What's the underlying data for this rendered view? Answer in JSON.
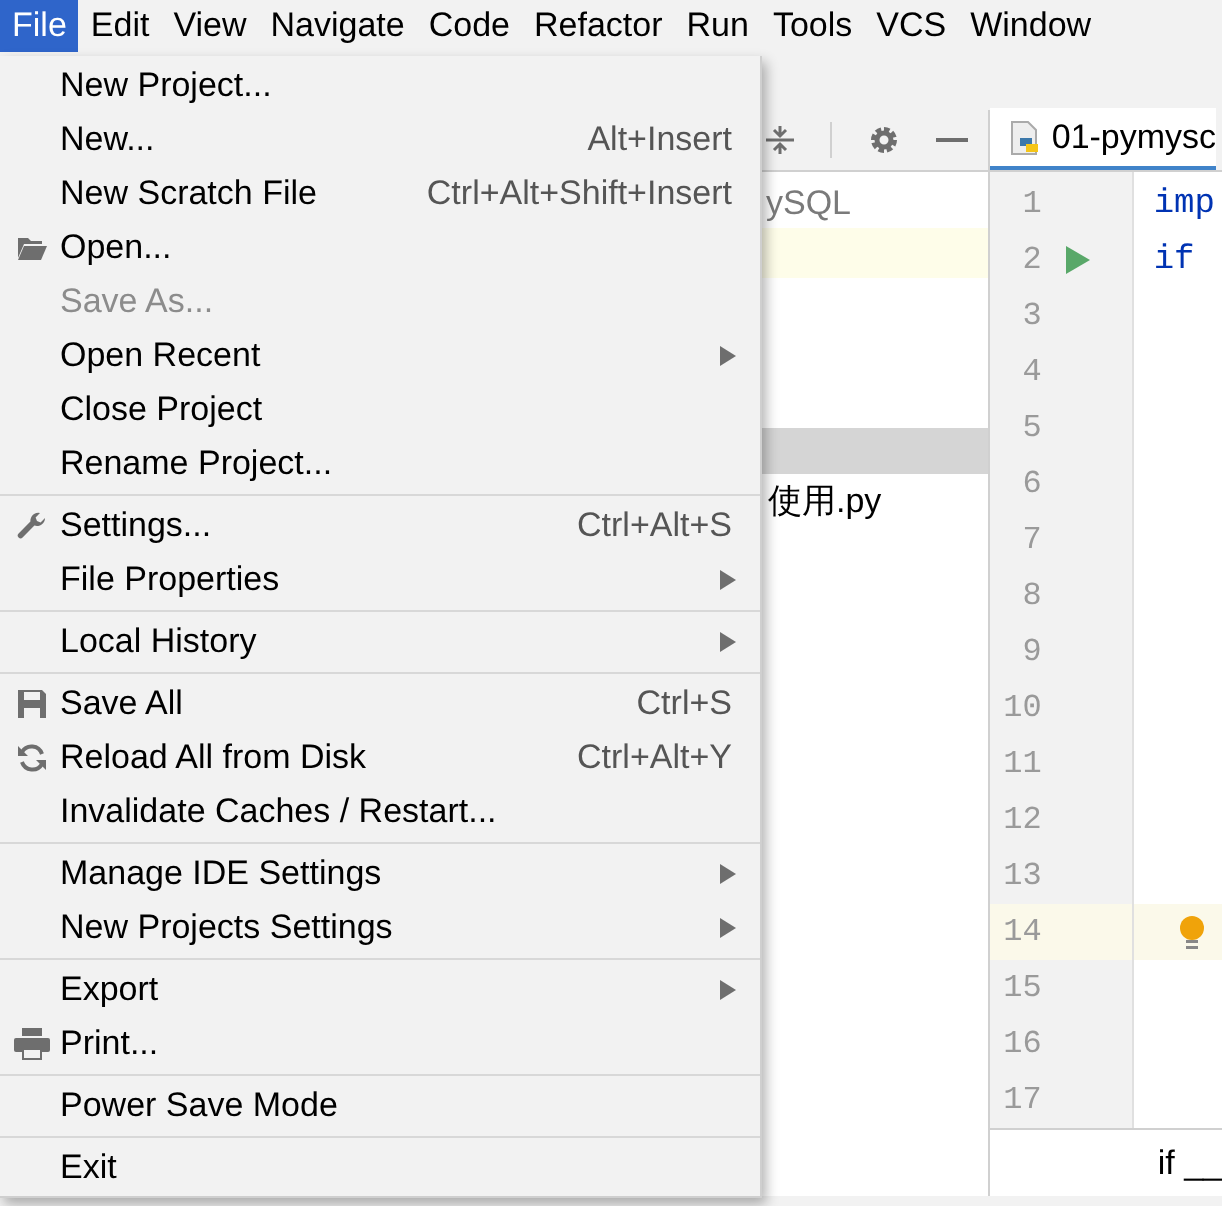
{
  "menu_bar": [
    {
      "label": "File",
      "selected": true
    },
    {
      "label": "Edit",
      "selected": false
    },
    {
      "label": "View",
      "selected": false
    },
    {
      "label": "Navigate",
      "selected": false
    },
    {
      "label": "Code",
      "selected": false
    },
    {
      "label": "Refactor",
      "selected": false
    },
    {
      "label": "Run",
      "selected": false
    },
    {
      "label": "Tools",
      "selected": false
    },
    {
      "label": "VCS",
      "selected": false
    },
    {
      "label": "Window",
      "selected": false
    }
  ],
  "file_menu": [
    {
      "kind": "item",
      "label": "New Project...",
      "disabled": false,
      "submenu": false
    },
    {
      "kind": "item",
      "label": "New...",
      "shortcut": "Alt+Insert",
      "disabled": false,
      "submenu": false
    },
    {
      "kind": "item",
      "label": "New Scratch File",
      "shortcut": "Ctrl+Alt+Shift+Insert",
      "disabled": false,
      "submenu": false
    },
    {
      "kind": "item",
      "label": "Open...",
      "disabled": false,
      "submenu": false
    },
    {
      "kind": "item",
      "label": "Save As...",
      "disabled": true,
      "submenu": false
    },
    {
      "kind": "item",
      "label": "Open Recent",
      "disabled": false,
      "submenu": true
    },
    {
      "kind": "item",
      "label": "Close Project",
      "disabled": false,
      "submenu": false
    },
    {
      "kind": "item",
      "label": "Rename Project...",
      "disabled": false,
      "submenu": false
    },
    {
      "kind": "separator"
    },
    {
      "kind": "item",
      "label": "Settings...",
      "shortcut": "Ctrl+Alt+S",
      "disabled": false,
      "submenu": false
    },
    {
      "kind": "item",
      "label": "File Properties",
      "disabled": false,
      "submenu": true
    },
    {
      "kind": "separator"
    },
    {
      "kind": "item",
      "label": "Local History",
      "disabled": false,
      "submenu": true
    },
    {
      "kind": "separator"
    },
    {
      "kind": "item",
      "label": "Save All",
      "shortcut": "Ctrl+S",
      "disabled": false,
      "submenu": false
    },
    {
      "kind": "item",
      "label": "Reload All from Disk",
      "shortcut": "Ctrl+Alt+Y",
      "disabled": false,
      "submenu": false
    },
    {
      "kind": "item",
      "label": "Invalidate Caches / Restart...",
      "disabled": false,
      "submenu": false
    },
    {
      "kind": "separator"
    },
    {
      "kind": "item",
      "label": "Manage IDE Settings",
      "disabled": false,
      "submenu": true
    },
    {
      "kind": "item",
      "label": "New Projects Settings",
      "disabled": false,
      "submenu": true
    },
    {
      "kind": "separator"
    },
    {
      "kind": "item",
      "label": "Export",
      "disabled": false,
      "submenu": true
    },
    {
      "kind": "item",
      "label": "Print...",
      "disabled": false,
      "submenu": false
    },
    {
      "kind": "separator"
    },
    {
      "kind": "item",
      "label": "Power Save Mode",
      "disabled": false,
      "submenu": false
    },
    {
      "kind": "separator"
    },
    {
      "kind": "item",
      "label": "Exit",
      "disabled": false,
      "submenu": false
    }
  ],
  "project_tree": {
    "rows": [
      {
        "label": "ySQL",
        "selected": false
      },
      {
        "label": "使用.py",
        "selected": false
      }
    ]
  },
  "editor": {
    "tab": "01-pymysc",
    "lines": [
      {
        "number": "1",
        "code": "imp"
      },
      {
        "number": "2",
        "code": "if",
        "run": true
      },
      {
        "number": "3"
      },
      {
        "number": "4"
      },
      {
        "number": "5"
      },
      {
        "number": "6"
      },
      {
        "number": "7"
      },
      {
        "number": "8"
      },
      {
        "number": "9"
      },
      {
        "number": "10"
      },
      {
        "number": "11"
      },
      {
        "number": "12"
      },
      {
        "number": "13"
      },
      {
        "number": "14",
        "hint": true
      },
      {
        "number": "15"
      },
      {
        "number": "16"
      },
      {
        "number": "17"
      }
    ],
    "breadcrumb": "if __"
  }
}
